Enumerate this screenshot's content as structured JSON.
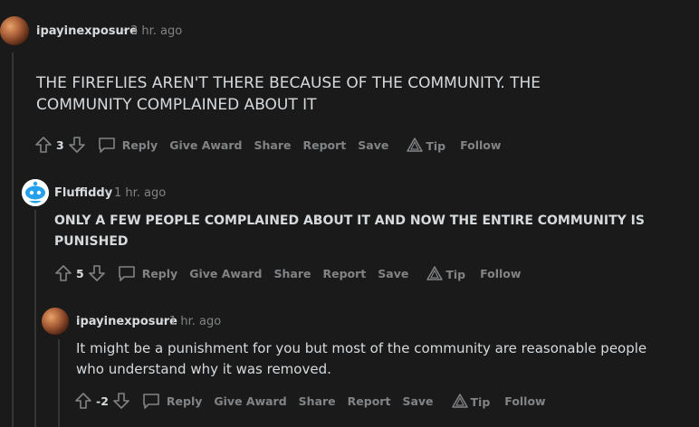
{
  "comments": [
    {
      "username": "ipayinexposure",
      "time": "3 hr. ago",
      "body": "THE FIREFLIES AREN'T THERE BECAUSE OF THE COMMUNITY. THE COMMUNITY COMPLAINED ABOUT IT",
      "votes": "3"
    },
    {
      "username": "Fluffiddy",
      "time": "1 hr. ago",
      "body": "ONLY A FEW PEOPLE COMPLAINED ABOUT IT AND NOW THE ENTIRE COMMUNITY IS PUNISHED",
      "votes": "5"
    },
    {
      "username": "ipayinexposure",
      "time": "1 hr. ago",
      "body": "It might be a punishment for you but most of the community are reasonable people who understand why it was removed.",
      "votes": "-2"
    }
  ],
  "actions": {
    "reply": "Reply",
    "give_award": "Give Award",
    "share": "Share",
    "report": "Report",
    "save": "Save",
    "tip": "Tip",
    "follow": "Follow"
  },
  "separator": "·",
  "colors": {
    "background": "#1a1a1b",
    "text": "#d7dadc",
    "muted": "#818384",
    "thread_line": "#343536"
  }
}
